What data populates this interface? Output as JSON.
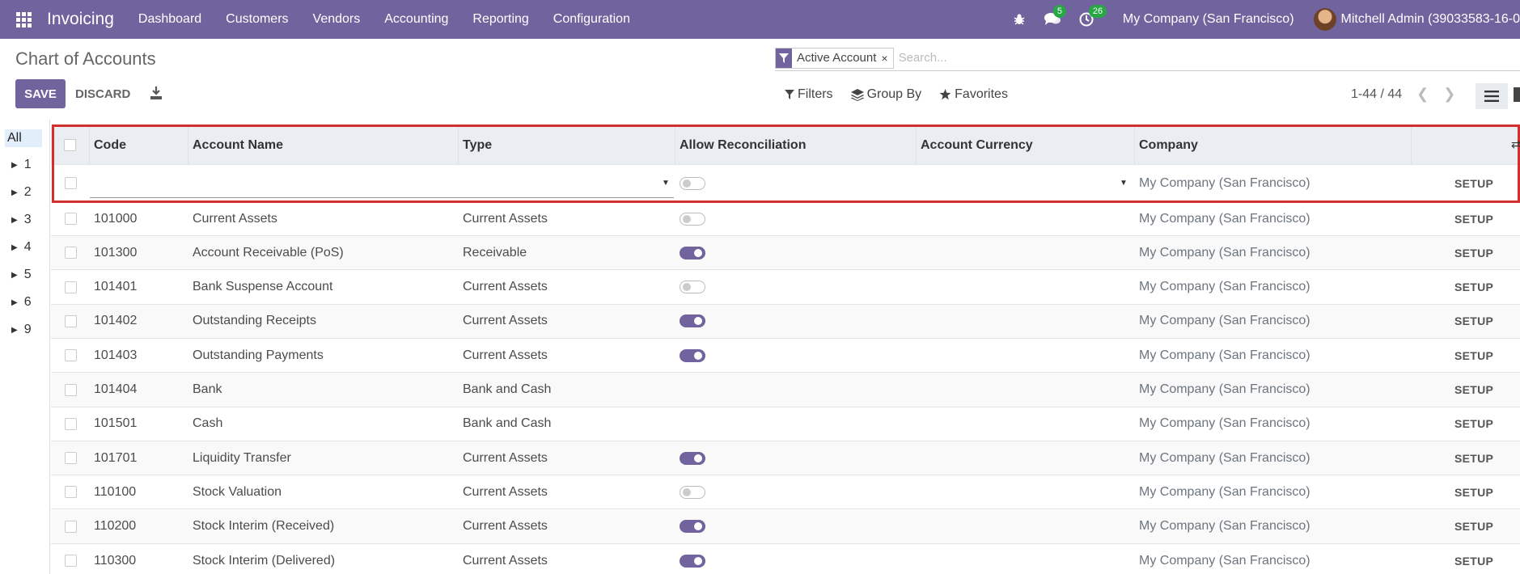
{
  "navbar": {
    "app_name": "Invoicing",
    "menu": [
      "Dashboard",
      "Customers",
      "Vendors",
      "Accounting",
      "Reporting",
      "Configuration"
    ],
    "messages_count": "5",
    "activities_count": "26",
    "company": "My Company (San Francisco)",
    "user": "Mitchell Admin (39033583-16-0",
    "brand_color": "#71639e",
    "badge_color": "#28a745"
  },
  "control_panel": {
    "title": "Chart of Accounts",
    "save_label": "SAVE",
    "discard_label": "DISCARD",
    "facet_value": "Active Account",
    "facet_remove": "×",
    "search_placeholder": "Search...",
    "filters_label": "Filters",
    "groupby_label": "Group By",
    "favorites_label": "Favorites",
    "pager": "1-44 / 44"
  },
  "sidebar": {
    "all_label": "All",
    "items": [
      "1",
      "2",
      "3",
      "4",
      "5",
      "6",
      "9"
    ]
  },
  "table": {
    "columns": [
      "Code",
      "Account Name",
      "Type",
      "Allow Reconciliation",
      "Account Currency",
      "Company"
    ],
    "edit_row": {
      "company": "My Company (San Francisco)",
      "setup": "SETUP",
      "reconcile": false
    },
    "rows": [
      {
        "code": "101000",
        "name": "Current Assets",
        "type": "Current Assets",
        "reconcile": "off",
        "company": "My Company (San Francisco)",
        "setup": "SETUP"
      },
      {
        "code": "101300",
        "name": "Account Receivable (PoS)",
        "type": "Receivable",
        "reconcile": "on",
        "company": "My Company (San Francisco)",
        "setup": "SETUP"
      },
      {
        "code": "101401",
        "name": "Bank Suspense Account",
        "type": "Current Assets",
        "reconcile": "off",
        "company": "My Company (San Francisco)",
        "setup": "SETUP"
      },
      {
        "code": "101402",
        "name": "Outstanding Receipts",
        "type": "Current Assets",
        "reconcile": "on",
        "company": "My Company (San Francisco)",
        "setup": "SETUP"
      },
      {
        "code": "101403",
        "name": "Outstanding Payments",
        "type": "Current Assets",
        "reconcile": "on",
        "company": "My Company (San Francisco)",
        "setup": "SETUP"
      },
      {
        "code": "101404",
        "name": "Bank",
        "type": "Bank and Cash",
        "reconcile": "none",
        "company": "My Company (San Francisco)",
        "setup": "SETUP"
      },
      {
        "code": "101501",
        "name": "Cash",
        "type": "Bank and Cash",
        "reconcile": "none",
        "company": "My Company (San Francisco)",
        "setup": "SETUP"
      },
      {
        "code": "101701",
        "name": "Liquidity Transfer",
        "type": "Current Assets",
        "reconcile": "on",
        "company": "My Company (San Francisco)",
        "setup": "SETUP"
      },
      {
        "code": "110100",
        "name": "Stock Valuation",
        "type": "Current Assets",
        "reconcile": "off",
        "company": "My Company (San Francisco)",
        "setup": "SETUP"
      },
      {
        "code": "110200",
        "name": "Stock Interim (Received)",
        "type": "Current Assets",
        "reconcile": "on",
        "company": "My Company (San Francisco)",
        "setup": "SETUP"
      },
      {
        "code": "110300",
        "name": "Stock Interim (Delivered)",
        "type": "Current Assets",
        "reconcile": "on",
        "company": "My Company (San Francisco)",
        "setup": "SETUP"
      }
    ]
  }
}
